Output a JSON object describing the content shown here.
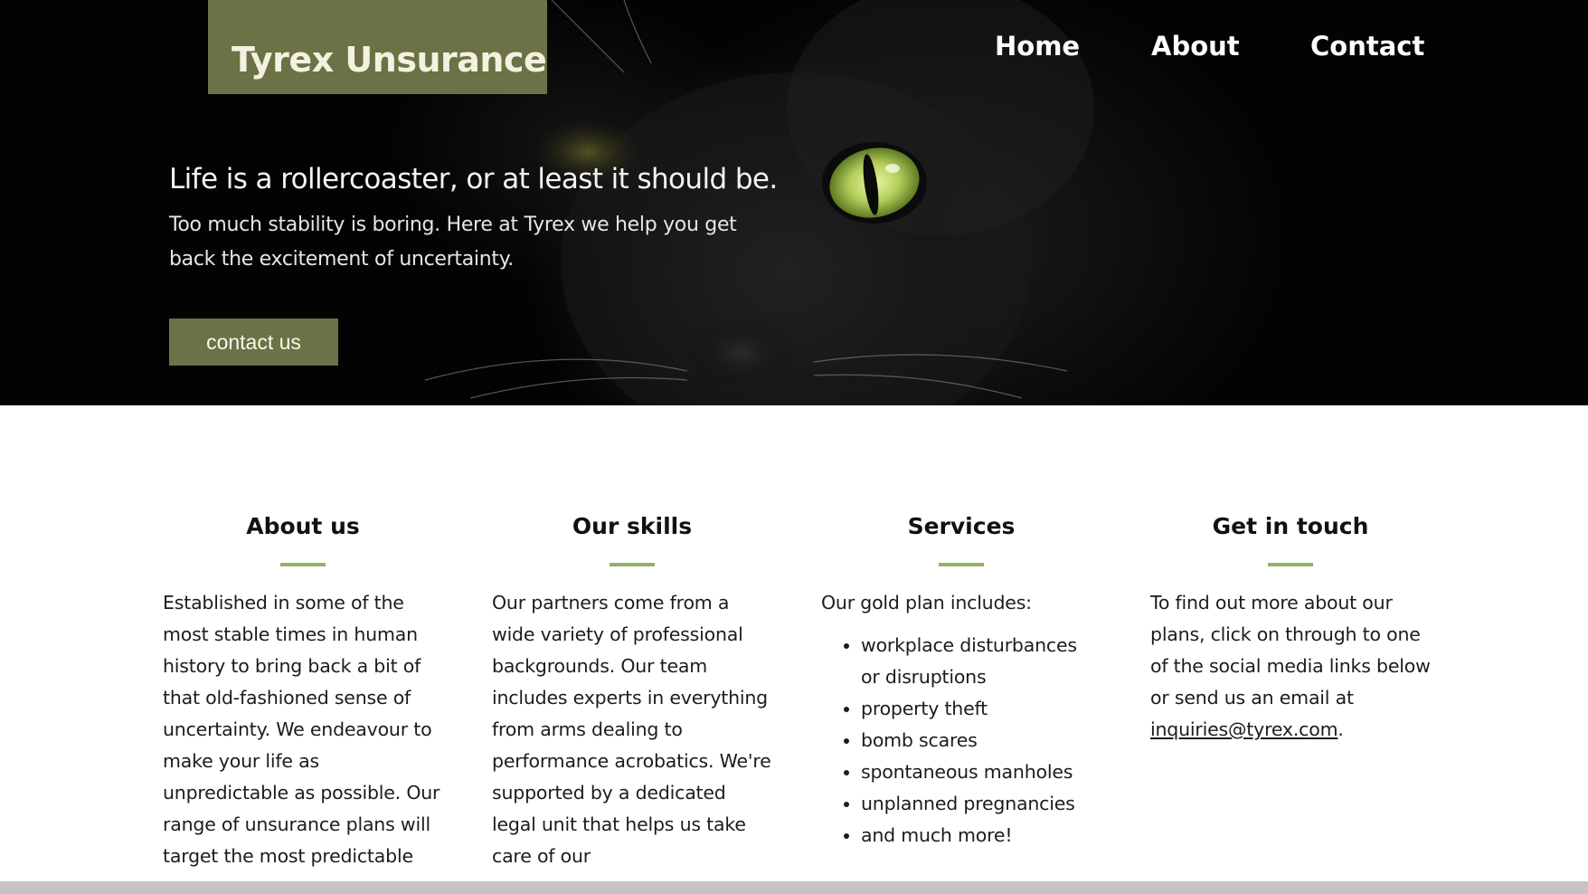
{
  "brand": {
    "name": "Tyrex Unsurance",
    "color": "#6b7245"
  },
  "nav": {
    "items": [
      "Home",
      "About",
      "Contact"
    ]
  },
  "hero": {
    "title": "Life is a rollercoaster, or at least it should be.",
    "subtitle": "Too much stability is boring. Here at Tyrex we help you get back the excitement of uncertainty.",
    "cta_label": "contact us",
    "background_image": "black-cat-green-eye"
  },
  "sections": {
    "about": {
      "heading": "About us",
      "text": "Established in some of the most stable times in human history to bring back a bit of that old-fashioned sense of uncertainty. We endeavour to make your life as unpredictable as possible. Our range of unsurance plans will target the most predictable"
    },
    "skills": {
      "heading": "Our skills",
      "text": "Our partners come from a wide variety of professional backgrounds. Our team includes experts in everything from arms dealing to performance acrobatics. We're supported by a dedicated legal unit that helps us take care of our"
    },
    "services": {
      "heading": "Services",
      "intro": "Our gold plan includes:",
      "items": [
        "workplace disturbances or disruptions",
        "property theft",
        "bomb scares",
        "spontaneous manholes",
        "unplanned pregnancies",
        "and much more!"
      ]
    },
    "contact": {
      "heading": "Get in touch",
      "text_before": "To find out more about our plans, click on through to one of the social media links below or send us an email at",
      "email": "inquiries@tyrex.com",
      "text_after": "."
    }
  },
  "colors": {
    "accent": "#94b267",
    "button": "#6b7245",
    "text": "#1a1a1a",
    "footer_bar": "#c4c4c4"
  }
}
